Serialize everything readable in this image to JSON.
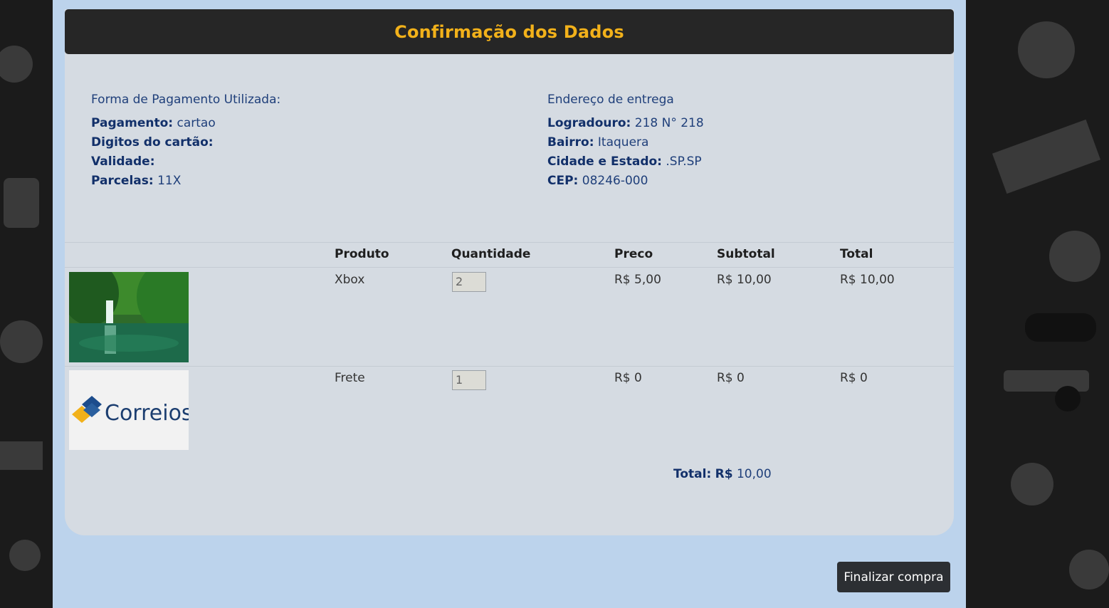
{
  "header": {
    "title": "Confirmação dos Dados"
  },
  "payment": {
    "heading": "Forma de Pagamento Utilizada:",
    "method_label": "Pagamento:",
    "method_value": "cartao",
    "card_digits_label": "Digitos do cartão:",
    "card_digits_value": "",
    "validity_label": "Validade:",
    "validity_value": "",
    "installments_label": "Parcelas:",
    "installments_value": "11X"
  },
  "address": {
    "heading": "Endereço de entrega",
    "street_label": "Logradouro:",
    "street_value": "218 N° 218",
    "district_label": "Bairro:",
    "district_value": "Itaquera",
    "city_label": "Cidade e Estado:",
    "city_value": ".SP.SP",
    "cep_label": "CEP:",
    "cep_value": "08246-000"
  },
  "table": {
    "columns": [
      "Produto",
      "Quantidade",
      "Preco",
      "Subtotal",
      "Total"
    ],
    "rows": [
      {
        "image": "waterfall-photo",
        "product": "Xbox",
        "quantity": "2",
        "price": "R$ 5,00",
        "subtotal": "R$ 10,00",
        "total": "R$ 10,00"
      },
      {
        "image": "correios-logo",
        "logo_text": "Correios",
        "product": "Frete",
        "quantity": "1",
        "price": "R$ 0",
        "subtotal": "R$ 0",
        "total": "R$ 0"
      }
    ]
  },
  "summary": {
    "total_label": "Total:",
    "currency": "R$",
    "total_value": "10,00"
  },
  "actions": {
    "finish_label": "Finalizar compra"
  },
  "colors": {
    "header_bg": "#262626",
    "header_title": "#f2b11a",
    "page_bg": "#bcd3ec",
    "button_bg": "#2c2f33",
    "text_blue": "#1f3f7a"
  }
}
